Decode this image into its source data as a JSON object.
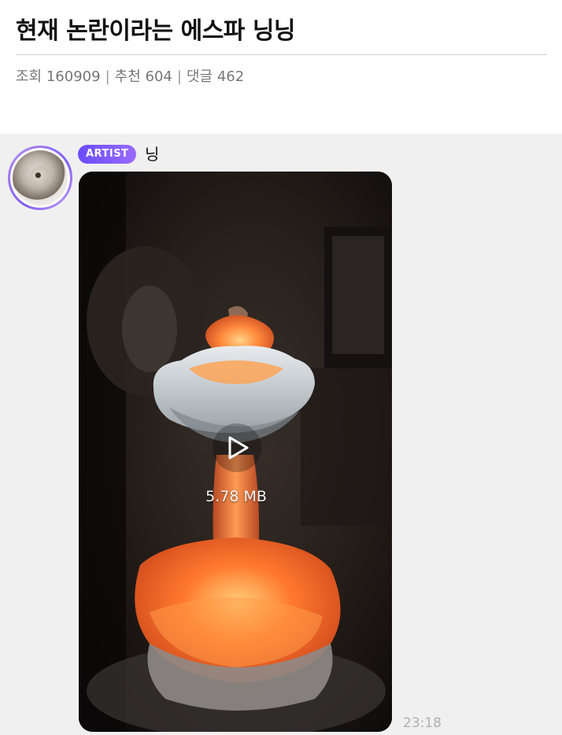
{
  "post": {
    "title": "현재 논란이라는 에스파 닝닝",
    "views_label": "조회",
    "views": "160909",
    "likes_label": "추천",
    "likes": "604",
    "comments_label": "댓글",
    "comments": "462"
  },
  "message": {
    "badge": "ARTIST",
    "sender": "닝",
    "file_size": "5.78 MB",
    "time": "23:18"
  },
  "colors": {
    "badge_gradient_start": "#6a4cff",
    "badge_gradient_end": "#9a6bff",
    "chat_background": "#f0f0f0"
  },
  "icons": {
    "play": "play-icon"
  }
}
